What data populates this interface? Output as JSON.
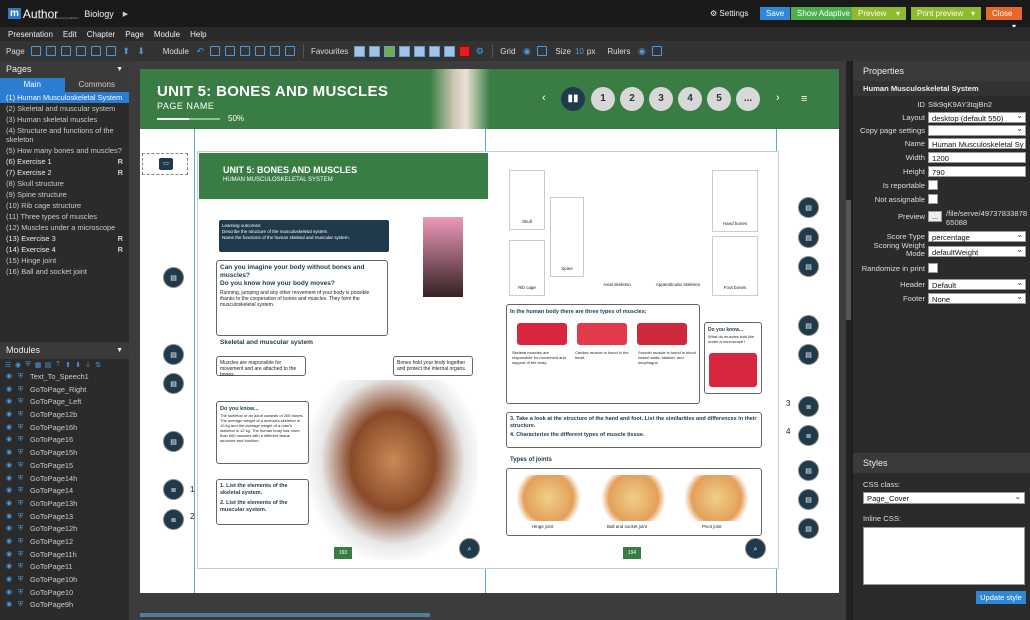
{
  "app": {
    "name": "Author",
    "prefix": "m",
    "subtitle": "educational development platform",
    "project": "Biology"
  },
  "topbar": {
    "settings": "Settings",
    "save": "Save",
    "show_adaptive": "Show Adaptive",
    "preview": "Preview",
    "print_preview": "Print preview",
    "close": "Close"
  },
  "menu": [
    "Presentation",
    "Edit",
    "Chapter",
    "Page",
    "Module",
    "Help"
  ],
  "toolbar": {
    "page": "Page",
    "module": "Module",
    "favourites": "Favourites",
    "grid": "Grid",
    "size": "Size",
    "size_value": "10",
    "size_unit": "px",
    "rulers": "Rulers"
  },
  "pages_panel": {
    "title": "Pages",
    "tab_main": "Main",
    "tab_commons": "Commons",
    "items": [
      {
        "label": "(1) Human Musculoskeletal System",
        "selected": true,
        "r": ""
      },
      {
        "label": "(2) Skeletal and muscular system",
        "r": ""
      },
      {
        "label": "(3) Human skeletal muscles",
        "r": ""
      },
      {
        "label": "(4) Structure and functions of the skeleton",
        "r": ""
      },
      {
        "label": "(5) How many bones and muscles?",
        "r": ""
      },
      {
        "label": "(6) Exercise 1",
        "r": "R"
      },
      {
        "label": "(7) Exercise 2",
        "r": "R"
      },
      {
        "label": "(8) Skull structure",
        "r": ""
      },
      {
        "label": "(9) Spine structure",
        "r": ""
      },
      {
        "label": "(10) Rib cage structure",
        "r": ""
      },
      {
        "label": "(11) Three types of muscles",
        "r": ""
      },
      {
        "label": "(12) Muscles under a microscope",
        "r": ""
      },
      {
        "label": "(13) Exercise 3",
        "r": "R"
      },
      {
        "label": "(14) Exercise 4",
        "r": "R"
      },
      {
        "label": "(15) Hinge joint",
        "r": ""
      },
      {
        "label": "(16) Ball and socket joint",
        "r": ""
      }
    ]
  },
  "modules_panel": {
    "title": "Modules",
    "items": [
      "Text_To_Speech1",
      "GoToPage_Right",
      "GoToPage_Left",
      "GoToPage12b",
      "GoToPage16h",
      "GoToPage16",
      "GoToPage15h",
      "GoToPage15",
      "GoToPage14h",
      "GoToPage14",
      "GoToPage13h",
      "GoToPage13",
      "GoToPage12h",
      "GoToPage12",
      "GoToPage11h",
      "GoToPage11",
      "GoToPage10h",
      "GoToPage10",
      "GoToPage9h"
    ]
  },
  "canvas": {
    "unit_title": "UNIT 5: BONES AND MUSCLES",
    "page_name": "PAGE NAME",
    "progress": 50,
    "progress_label": "50%",
    "nav_pages": [
      "1",
      "2",
      "3",
      "4",
      "5",
      "..."
    ],
    "book": {
      "title": "UNIT 5: BONES AND MUSCLES",
      "subtitle": "HUMAN MUSCULOSKELETAL SYSTEM",
      "outcomes_title": "Learning outcomes:",
      "outcome1": "Describe the structure of the musculoskeletal system.",
      "outcome2": "Name the functions of the human skeletal and muscular system.",
      "q1": "Can you imagine your body without bones and muscles?",
      "q2": "Do you know how your body moves?",
      "intro": "Running, jumping and any other movement of your body is possible thanks to the cooperation of bones and muscles. They form the musculoskeletal system.",
      "section": "Skeletal and muscular system",
      "muscles": "Muscles are responsible for movement and are attached to the bones.",
      "bones": "Bones hold your body together and protect the internal organs.",
      "know_title": "Do you know...",
      "know_text": "The skeleton of an adult consists of 206 bones. The average weight of a woman's skeleton is 10 kg and the average weight of a man's skeleton is 12 kg. The human body has more than 600 muscles with a different tissue structure and function.",
      "task1": "1. List the elements of the skeletal system.",
      "task2": "2. List the elements of the muscular system.",
      "page_left": "193",
      "page_right": "194",
      "skull": "Skull",
      "spine": "Spine",
      "rib_cage": "Rib cage",
      "axial": "Axial skeleton",
      "appendicular": "Appendicular skeleton",
      "hand": "Hand bones",
      "foot": "Foot bones",
      "muscle_types_title": "In the human body there are three types of muscles:",
      "skeletal_muscles": "Skeletal muscles are responsible for movement and support of the body.",
      "cardiac_muscle": "Cardiac muscle is found in the heart.",
      "smooth_muscle": "Smooth muscle is found in blood vessel walls, bladder, and esophagus.",
      "know2_title": "Do you know...",
      "know2_text": "What do muscles look like under a microscope?",
      "task3": "3. Take a look at the structure of the hand and foot. List the similarities and differences in their structure.",
      "task4": "4. Characterize the different types of muscle tissue.",
      "joints_title": "Types of joints",
      "hinge": "Hinge joint",
      "ball": "Ball and socket joint",
      "pivot": "Pivot joint",
      "m1": "1",
      "m2": "2",
      "m3": "3",
      "m4": "4"
    }
  },
  "properties": {
    "title": "Properties",
    "component": "Human Musculoskeletal System",
    "fields": [
      {
        "label": "ID",
        "value": "Stk9qK9AY3tqjBn2",
        "type": "text"
      },
      {
        "label": "Layout",
        "value": "desktop (default 550)",
        "type": "select"
      },
      {
        "label": "Copy page settings",
        "value": "",
        "type": "select"
      },
      {
        "label": "Name",
        "value": "Human Musculoskeletal Sy",
        "type": "input"
      },
      {
        "label": "Width",
        "value": "1200",
        "type": "input"
      },
      {
        "label": "Height",
        "value": "790",
        "type": "input"
      },
      {
        "label": "Is reportable",
        "value": "",
        "type": "check"
      },
      {
        "label": "Not assignable",
        "value": "",
        "type": "check"
      },
      {
        "label": "Preview",
        "value": "/file/serve/4973783387865088",
        "type": "preview"
      },
      {
        "label": "Score Type",
        "value": "percentage",
        "type": "select"
      },
      {
        "label": "Scoring Weight Mode",
        "value": "defaultWeight",
        "type": "select"
      },
      {
        "label": "Randomize in print",
        "value": "",
        "type": "check"
      },
      {
        "label": "Header",
        "value": "Default",
        "type": "select"
      },
      {
        "label": "Footer",
        "value": "None",
        "type": "select"
      }
    ]
  },
  "styles": {
    "title": "Styles",
    "css_class_label": "CSS class:",
    "css_class": "Page_Cover",
    "inline_css_label": "Inline CSS:",
    "update": "Update style"
  }
}
